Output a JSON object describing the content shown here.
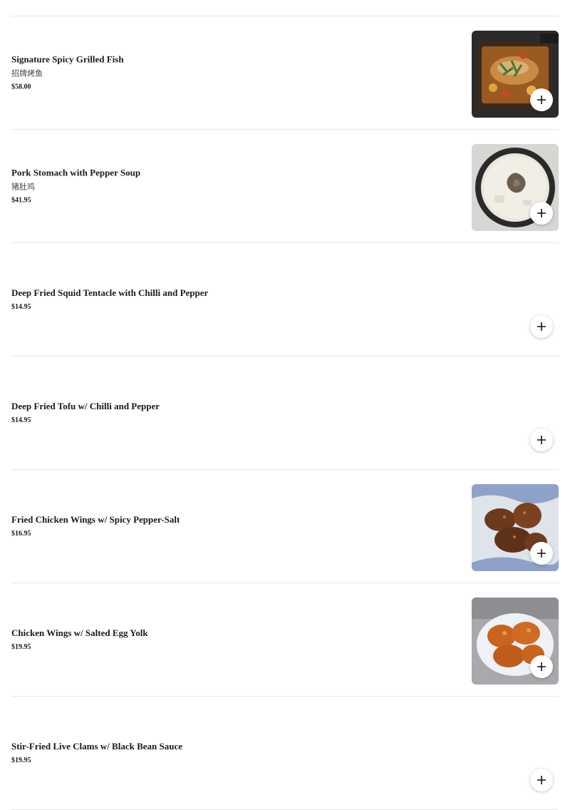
{
  "menu": {
    "items": [
      {
        "name": "Signature Spicy Grilled Fish",
        "subtitle": "招牌烤鱼",
        "price": "$58.00",
        "image": "grilled-fish-photo",
        "add_icon": "plus-icon"
      },
      {
        "name": "Pork Stomach with Pepper Soup",
        "subtitle": "猪肚鸡",
        "price": "$41.95",
        "image": "pork-stomach-soup-photo",
        "add_icon": "plus-icon"
      },
      {
        "name": "Deep Fried Squid Tentacle with Chilli and Pepper",
        "price": "$14.95",
        "add_icon": "plus-icon"
      },
      {
        "name": "Deep Fried Tofu w/ Chilli and Pepper",
        "price": "$14.95",
        "add_icon": "plus-icon"
      },
      {
        "name": "Fried Chicken Wings w/ Spicy Pepper-Salt",
        "price": "$16.95",
        "image": "fried-chicken-wings-photo",
        "add_icon": "plus-icon"
      },
      {
        "name": "Chicken Wings w/ Salted Egg Yolk",
        "price": "$19.95",
        "image": "salted-egg-yolk-wings-photo",
        "add_icon": "plus-icon"
      },
      {
        "name": "Stir-Fried Live Clams w/ Black Bean Sauce",
        "price": "$19.95",
        "add_icon": "plus-icon"
      }
    ]
  }
}
